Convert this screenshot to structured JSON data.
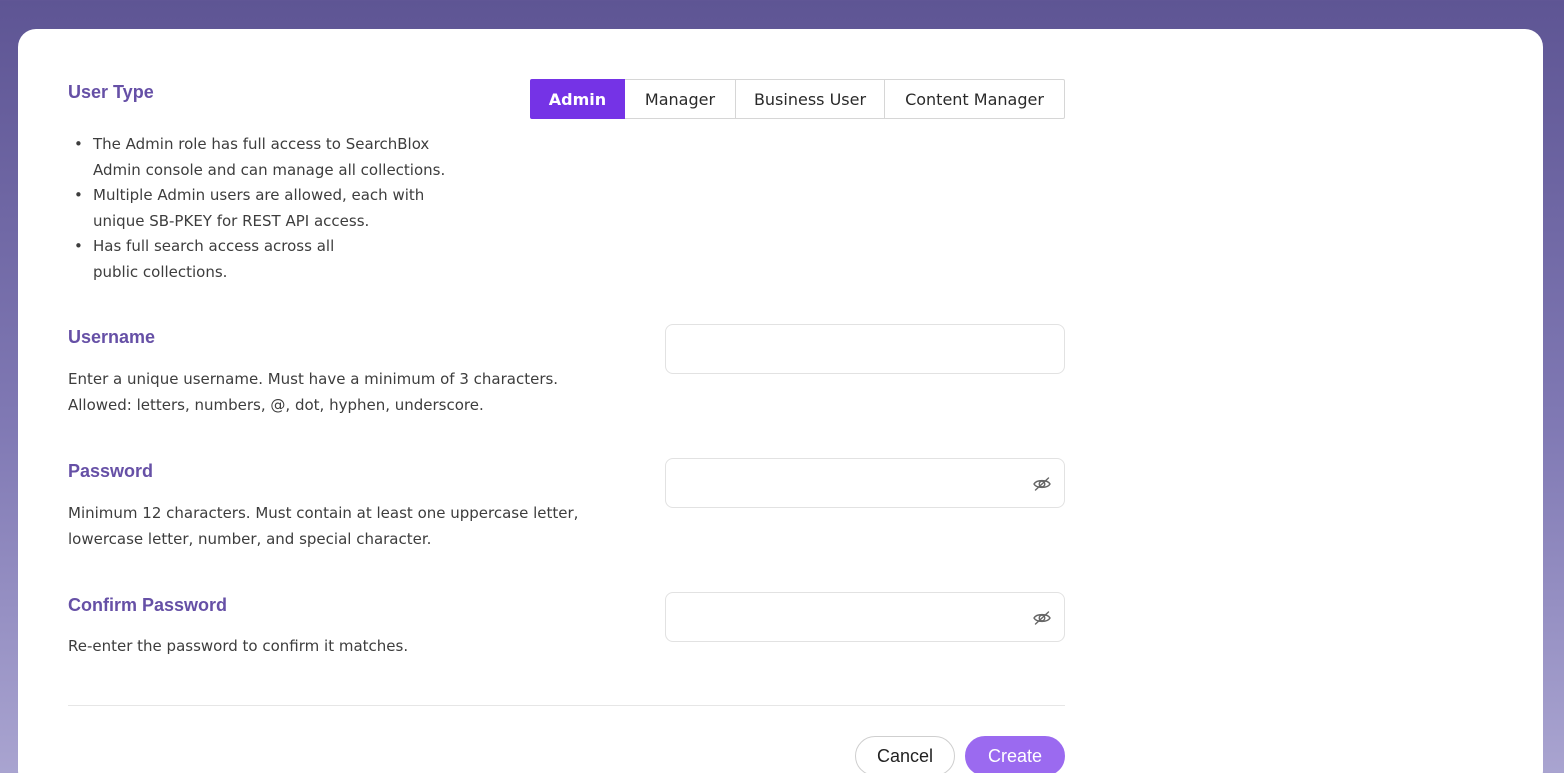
{
  "user_type": {
    "heading": "User Type",
    "roles": [
      "Admin",
      "Manager",
      "Business User",
      "Content Manager"
    ],
    "selected": "Admin",
    "description_bullets": [
      "The Admin role has full access to SearchBlox Admin console and can manage all collections.",
      "Multiple Admin users are allowed, each with unique SB-PKEY for REST API access.",
      "Has full search access across all public collections."
    ]
  },
  "username": {
    "heading": "Username",
    "description_line1": "Enter a unique username. Must have a minimum of 3 characters.",
    "description_line2": "Allowed: letters, numbers, @, dot, hyphen, underscore.",
    "value": ""
  },
  "password": {
    "heading": "Password",
    "description_line1": "Minimum 12 characters. Must contain at least one uppercase letter,",
    "description_line2": "lowercase letter, number, and special character.",
    "value": ""
  },
  "confirm_password": {
    "heading": "Confirm Password",
    "description": "Re-enter the password to confirm it matches.",
    "value": ""
  },
  "actions": {
    "cancel_label": "Cancel",
    "create_label": "Create"
  },
  "colors": {
    "accent": "#7533e6",
    "heading": "#6650a6",
    "create_button": "#9b6af0"
  },
  "icons": {
    "password_toggle": "eye-slash-icon",
    "confirm_password_toggle": "eye-slash-icon"
  }
}
